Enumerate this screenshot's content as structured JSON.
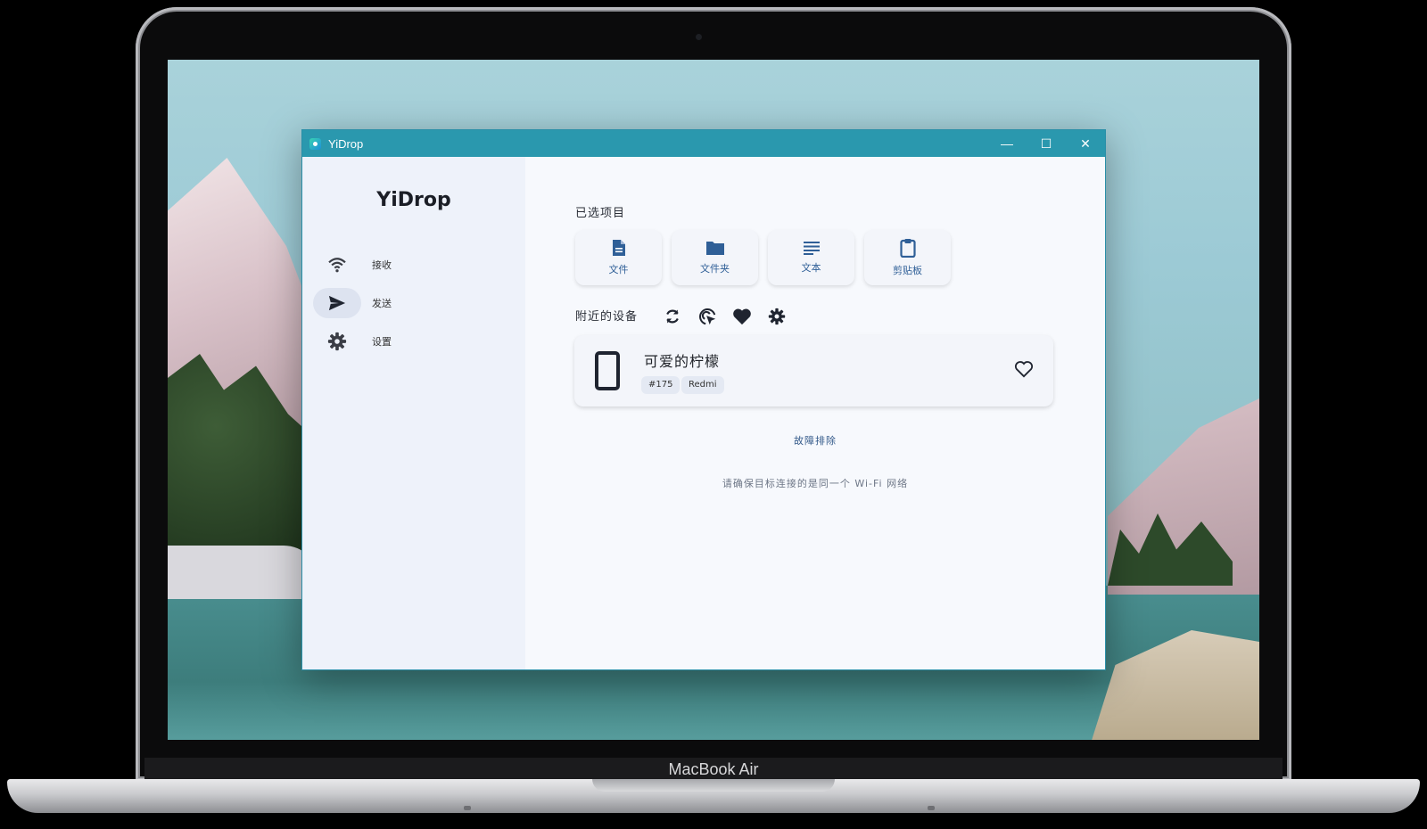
{
  "device": {
    "brand_label": "MacBook Air"
  },
  "window": {
    "title": "YiDrop",
    "minimize_glyph": "—",
    "maximize_glyph": "☐",
    "close_glyph": "✕"
  },
  "sidebar": {
    "logo": "YiDrop",
    "items": [
      {
        "label": "接收",
        "icon": "wifi-icon"
      },
      {
        "label": "发送",
        "icon": "send-icon",
        "active": true
      },
      {
        "label": "设置",
        "icon": "gear-icon"
      }
    ]
  },
  "main": {
    "selected_title": "已选项目",
    "tiles": [
      {
        "label": "文件",
        "icon": "file-icon"
      },
      {
        "label": "文件夹",
        "icon": "folder-icon"
      },
      {
        "label": "文本",
        "icon": "text-icon"
      },
      {
        "label": "剪贴板",
        "icon": "clipboard-icon"
      }
    ],
    "nearby_title": "附近的设备",
    "nearby_actions": [
      "refresh-icon",
      "target-click-icon",
      "heart-filled-icon",
      "gear-icon"
    ],
    "device": {
      "name": "可爱的柠檬",
      "tags": [
        "#175",
        "Redmi"
      ],
      "icon": "phone-icon",
      "favorite_icon": "heart-outline-icon"
    },
    "troubleshoot_label": "故障排除",
    "hint_text": "请确保目标连接的是同一个 Wi-Fi 网络"
  },
  "colors": {
    "titlebar": "#2a98ae",
    "accent": "#2f5f97",
    "sidebar_bg": "#eef2fa",
    "main_bg": "#f7f9fd"
  }
}
